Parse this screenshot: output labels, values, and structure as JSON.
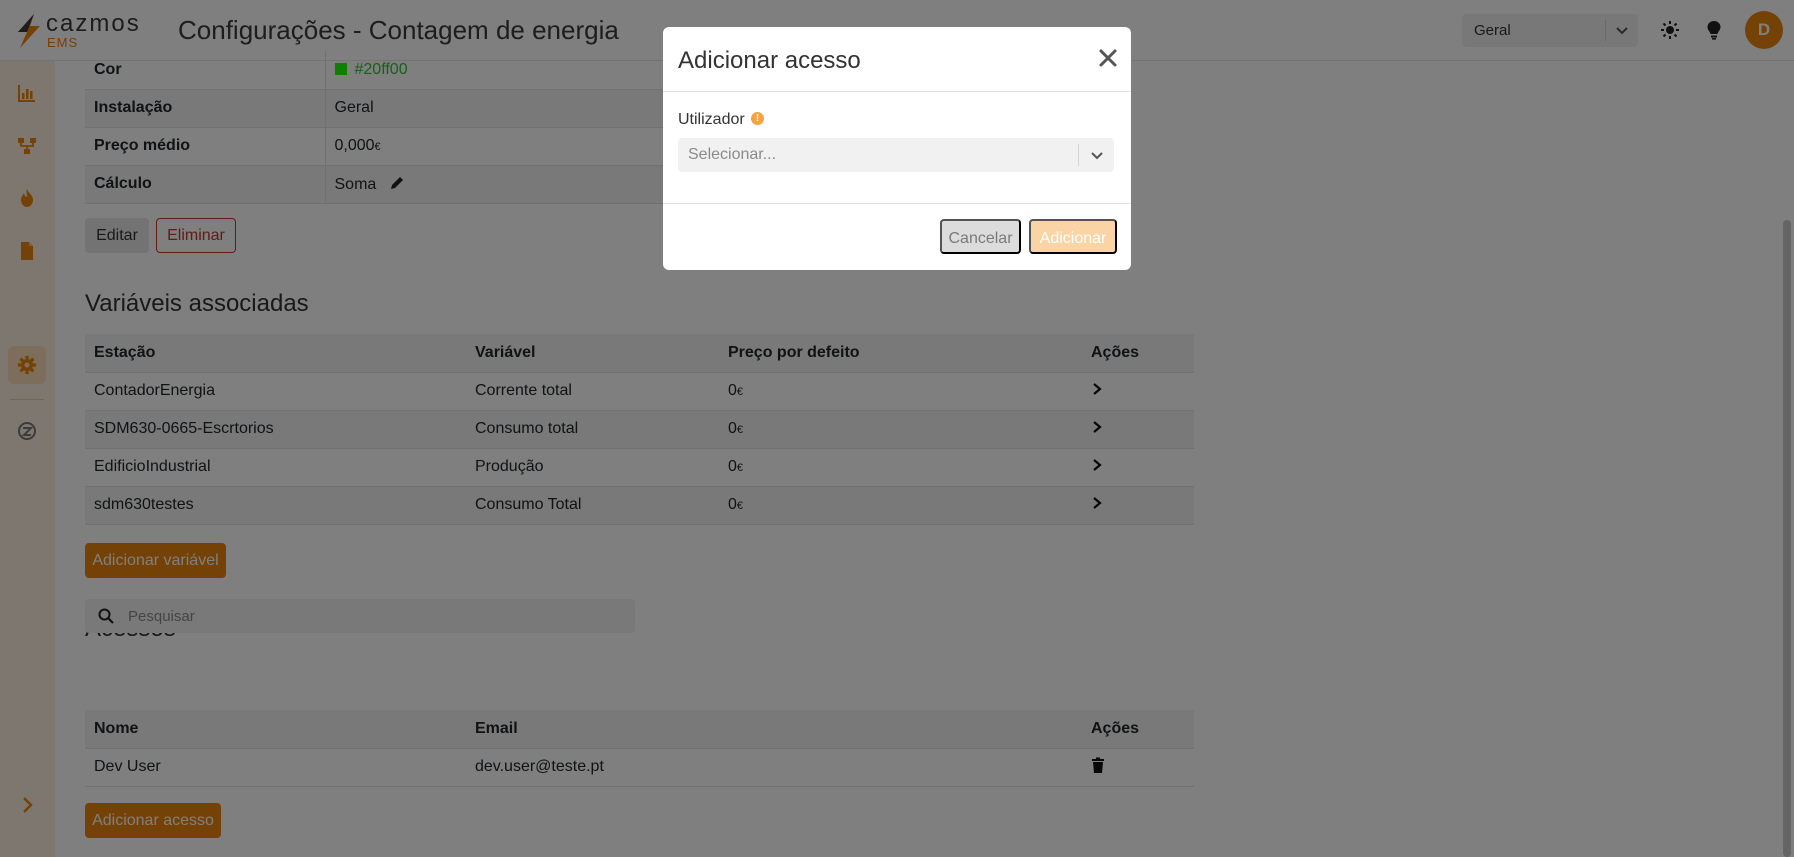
{
  "header": {
    "logo_name": "cazmos",
    "logo_sub": "EMS",
    "title": "Configurações - Contagem de energia",
    "site_select": "Geral",
    "avatar_initial": "D"
  },
  "sidebar": {
    "items": [
      "chart-icon",
      "network-icon",
      "flame-icon",
      "document-icon",
      "gear-icon",
      "brand-icon"
    ],
    "active": "gear-icon",
    "expand_icon": "chevron-right-icon"
  },
  "properties": {
    "rows": [
      {
        "key": "Cor",
        "value": "#20ff00",
        "color": "#20ff00"
      },
      {
        "key": "Instalação",
        "value": "Geral"
      },
      {
        "key": "Preço médio",
        "value": "0,000",
        "unit": "€"
      },
      {
        "key": "Cálculo",
        "value": "Soma"
      }
    ],
    "edit_label": "Editar",
    "delete_label": "Eliminar"
  },
  "variables": {
    "title": "Variáveis associadas",
    "columns": [
      "Estação",
      "Variável",
      "Preço por defeito",
      "Ações"
    ],
    "rows": [
      {
        "station": "ContadorEnergia",
        "variable": "Corrente total",
        "price": "0",
        "unit": "€"
      },
      {
        "station": "SDM630-0665-Escrtorios",
        "variable": "Consumo total",
        "price": "0",
        "unit": "€"
      },
      {
        "station": "EdificioIndustrial",
        "variable": "Produção",
        "price": "0",
        "unit": "€"
      },
      {
        "station": "sdm630testes",
        "variable": "Consumo Total",
        "price": "0",
        "unit": "€"
      }
    ],
    "add_label": "Adicionar variável"
  },
  "access": {
    "title": "Acessos",
    "search_placeholder": "Pesquisar",
    "columns": [
      "Nome",
      "Email",
      "Ações"
    ],
    "rows": [
      {
        "name": "Dev User",
        "email": "dev.user@teste.pt"
      }
    ],
    "add_label": "Adicionar acesso"
  },
  "modal": {
    "title": "Adicionar acesso",
    "field_label": "Utilizador",
    "select_placeholder": "Selecionar...",
    "cancel_label": "Cancelar",
    "submit_label": "Adicionar"
  },
  "colors": {
    "accent": "#e8830c",
    "sidebar_bg": "#fcefe0",
    "danger": "#c0392b"
  }
}
